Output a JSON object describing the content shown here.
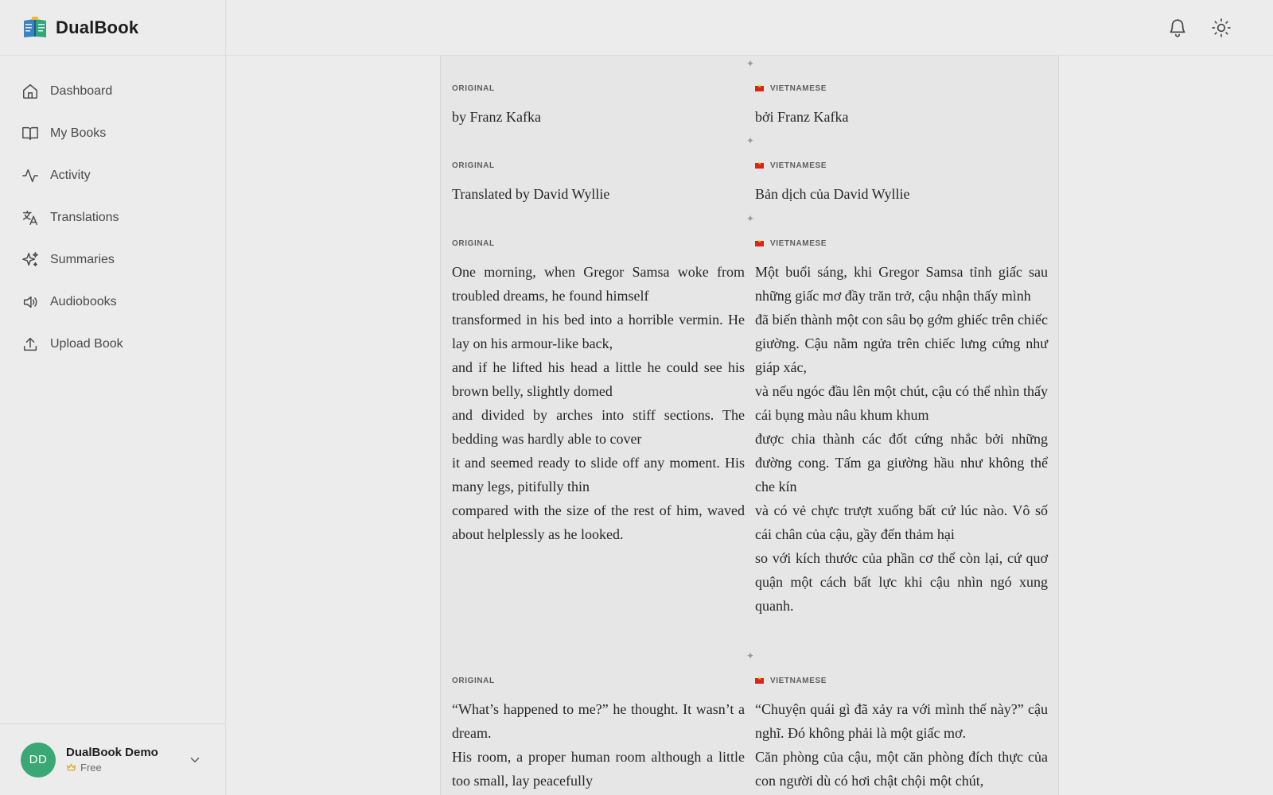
{
  "app": {
    "name": "DualBook"
  },
  "sidebar": {
    "items": [
      {
        "label": "Dashboard",
        "icon": "home-icon"
      },
      {
        "label": "My Books",
        "icon": "book-open-icon"
      },
      {
        "label": "Activity",
        "icon": "activity-icon"
      },
      {
        "label": "Translations",
        "icon": "translate-icon"
      },
      {
        "label": "Summaries",
        "icon": "sparkles-icon"
      },
      {
        "label": "Audiobooks",
        "icon": "speaker-icon"
      },
      {
        "label": "Upload Book",
        "icon": "upload-icon"
      }
    ]
  },
  "user": {
    "initials": "DD",
    "name": "DualBook Demo",
    "plan": "Free"
  },
  "header": {
    "icons": [
      "bell-icon",
      "sun-icon"
    ]
  },
  "reader": {
    "original_label": "ORIGINAL",
    "translation_label": "VIETNAMESE",
    "blocks": [
      {
        "original": [
          "by Franz Kafka"
        ],
        "translation": [
          "bởi Franz Kafka"
        ]
      },
      {
        "original": [
          "Translated by David Wyllie"
        ],
        "translation": [
          "Bản dịch của David Wyllie"
        ]
      },
      {
        "original": [
          "One morning, when Gregor Samsa woke from troubled dreams, he found himself",
          "transformed in his bed into a horrible vermin. He lay on his armour-like back,",
          "and if he lifted his head a little he could see his brown belly, slightly domed",
          "and divided by arches into stiff sections. The bedding was hardly able to cover",
          "it and seemed ready to slide off any moment. His many legs, pitifully thin",
          "compared with the size of the rest of him, waved about helplessly as he looked."
        ],
        "translation": [
          "Một buổi sáng, khi Gregor Samsa tỉnh giấc sau những giấc mơ đầy trăn trở, cậu nhận thấy mình",
          "đã biến thành một con sâu bọ gớm ghiếc trên chiếc giường. Cậu nằm ngửa trên chiếc lưng cứng như giáp xác,",
          "và nếu ngóc đầu lên một chút, cậu có thể nhìn thấy cái bụng màu nâu khum khum",
          "được chia thành các đốt cứng nhắc bởi những đường cong. Tấm ga giường hầu như không thể che kín",
          "và có vẻ chực trượt xuống bất cứ lúc nào. Vô số cái chân của cậu, gầy đến thảm hại",
          "so với kích thước của phần cơ thể còn lại, cứ quơ quận một cách bất lực khi cậu nhìn ngó xung quanh."
        ]
      },
      {
        "original": [
          "“What’s happened to me?” he thought. It wasn’t a dream.",
          "His room, a proper human room although a little too small, lay peacefully"
        ],
        "translation": [
          "“Chuyện quái gì đã xảy ra với mình thế này?” cậu nghĩ. Đó không phải là một giấc mơ.",
          "Căn phòng của cậu, một căn phòng đích thực của con người dù có hơi chật chội một chút,"
        ]
      }
    ]
  }
}
